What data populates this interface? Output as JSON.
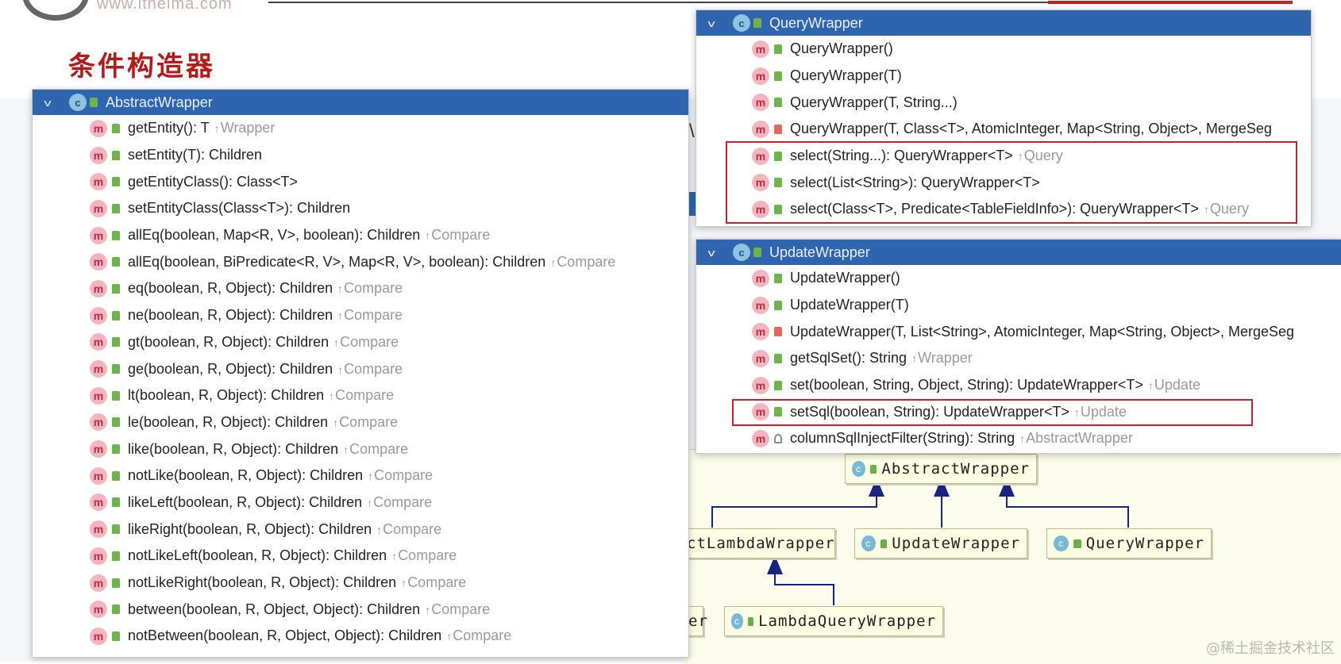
{
  "slide": {
    "site_url": "www.itheima.com",
    "title": "条件构造器",
    "fragment": "\\",
    "watermark": "@稀土掘金技术社区"
  },
  "colors": {
    "header_blue": "#2f65ae",
    "title_red": "#b01c1c",
    "highlight_red": "#c0252f",
    "inherited_gray": "#9a9a9a"
  },
  "icons": {
    "method": "m",
    "class": "c",
    "public": "green-lock-icon",
    "private": "red-lock-icon",
    "protected": "key-icon",
    "collapse": "chevron-down-icon"
  },
  "abstract_wrapper": {
    "header": "AbstractWrapper",
    "methods": [
      {
        "sig": "getEntity(): T",
        "from": "Wrapper",
        "access": "public"
      },
      {
        "sig": "setEntity(T): Children",
        "from": "",
        "access": "public"
      },
      {
        "sig": "getEntityClass(): Class<T>",
        "from": "",
        "access": "public"
      },
      {
        "sig": "setEntityClass(Class<T>): Children",
        "from": "",
        "access": "public"
      },
      {
        "sig": "allEq(boolean, Map<R, V>, boolean): Children",
        "from": "Compare",
        "access": "public"
      },
      {
        "sig": "allEq(boolean, BiPredicate<R, V>, Map<R, V>, boolean): Children",
        "from": "Compare",
        "access": "public"
      },
      {
        "sig": "eq(boolean, R, Object): Children",
        "from": "Compare",
        "access": "public"
      },
      {
        "sig": "ne(boolean, R, Object): Children",
        "from": "Compare",
        "access": "public"
      },
      {
        "sig": "gt(boolean, R, Object): Children",
        "from": "Compare",
        "access": "public"
      },
      {
        "sig": "ge(boolean, R, Object): Children",
        "from": "Compare",
        "access": "public"
      },
      {
        "sig": "lt(boolean, R, Object): Children",
        "from": "Compare",
        "access": "public"
      },
      {
        "sig": "le(boolean, R, Object): Children",
        "from": "Compare",
        "access": "public"
      },
      {
        "sig": "like(boolean, R, Object): Children",
        "from": "Compare",
        "access": "public"
      },
      {
        "sig": "notLike(boolean, R, Object): Children",
        "from": "Compare",
        "access": "public"
      },
      {
        "sig": "likeLeft(boolean, R, Object): Children",
        "from": "Compare",
        "access": "public"
      },
      {
        "sig": "likeRight(boolean, R, Object): Children",
        "from": "Compare",
        "access": "public"
      },
      {
        "sig": "notLikeLeft(boolean, R, Object): Children",
        "from": "Compare",
        "access": "public"
      },
      {
        "sig": "notLikeRight(boolean, R, Object): Children",
        "from": "Compare",
        "access": "public"
      },
      {
        "sig": "between(boolean, R, Object, Object): Children",
        "from": "Compare",
        "access": "public"
      },
      {
        "sig": "notBetween(boolean, R, Object, Object): Children",
        "from": "Compare",
        "access": "public"
      }
    ]
  },
  "query_wrapper": {
    "header": "QueryWrapper",
    "methods": [
      {
        "sig": "QueryWrapper()",
        "from": "",
        "access": "public"
      },
      {
        "sig": "QueryWrapper(T)",
        "from": "",
        "access": "public"
      },
      {
        "sig": "QueryWrapper(T, String...)",
        "from": "",
        "access": "public"
      },
      {
        "sig": "QueryWrapper(T, Class<T>, AtomicInteger, Map<String, Object>, MergeSeg",
        "from": "",
        "access": "private"
      },
      {
        "sig": "select(String...): QueryWrapper<T>",
        "from": "Query",
        "access": "public"
      },
      {
        "sig": "select(List<String>): QueryWrapper<T>",
        "from": "",
        "access": "public"
      },
      {
        "sig": "select(Class<T>, Predicate<TableFieldInfo>): QueryWrapper<T>",
        "from": "Query",
        "access": "public"
      }
    ]
  },
  "update_wrapper": {
    "header": "UpdateWrapper",
    "methods": [
      {
        "sig": "UpdateWrapper()",
        "from": "",
        "access": "public"
      },
      {
        "sig": "UpdateWrapper(T)",
        "from": "",
        "access": "public"
      },
      {
        "sig": "UpdateWrapper(T, List<String>, AtomicInteger, Map<String, Object>, MergeSeg",
        "from": "",
        "access": "private"
      },
      {
        "sig": "getSqlSet(): String",
        "from": "Wrapper",
        "access": "public"
      },
      {
        "sig": "set(boolean, String, Object, String): UpdateWrapper<T>",
        "from": "Update",
        "access": "public"
      },
      {
        "sig": "setSql(boolean, String): UpdateWrapper<T>",
        "from": "Update",
        "access": "public"
      },
      {
        "sig": "columnSqlInjectFilter(String): String",
        "from": "AbstractWrapper",
        "access": "protected"
      }
    ]
  },
  "uml": {
    "abstract": "AbstractWrapper",
    "lambda_partial": "ctLambdaWrapper",
    "update": "UpdateWrapper",
    "query": "QueryWrapper",
    "lambda_query": "LambdaQueryWrapper",
    "left_fragment": "er"
  }
}
